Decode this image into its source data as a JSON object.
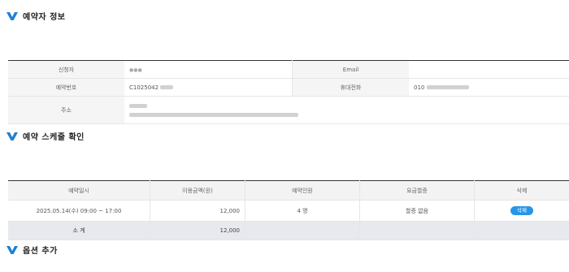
{
  "sections": {
    "reservation_info": "예약자 정보",
    "schedule": "예약 스케줄 확인",
    "options": "옵션 추가"
  },
  "info": {
    "applicant_label": "신청자",
    "applicant_value": "●●●",
    "email_label": "Email",
    "email_value": "",
    "reservation_no_label": "예약번호",
    "reservation_no_value": "C1025042",
    "phone_label": "휴대전화",
    "phone_value": "010",
    "address_label": "주소"
  },
  "schedule": {
    "headers": [
      "예약일시",
      "이용금액(원)",
      "예약인원",
      "요금할증",
      "삭제"
    ],
    "row": {
      "datetime": "2025.05.14(수) 09:00 ~ 17:00",
      "amount": "12,000",
      "people": "4 명",
      "surcharge": "할증 없음",
      "delete": "삭제"
    },
    "subtotal_label": "소 계",
    "subtotal_amount": "12,000"
  },
  "colors": {
    "accent": "#2796e8",
    "v_icon": "#1f7fd0"
  }
}
